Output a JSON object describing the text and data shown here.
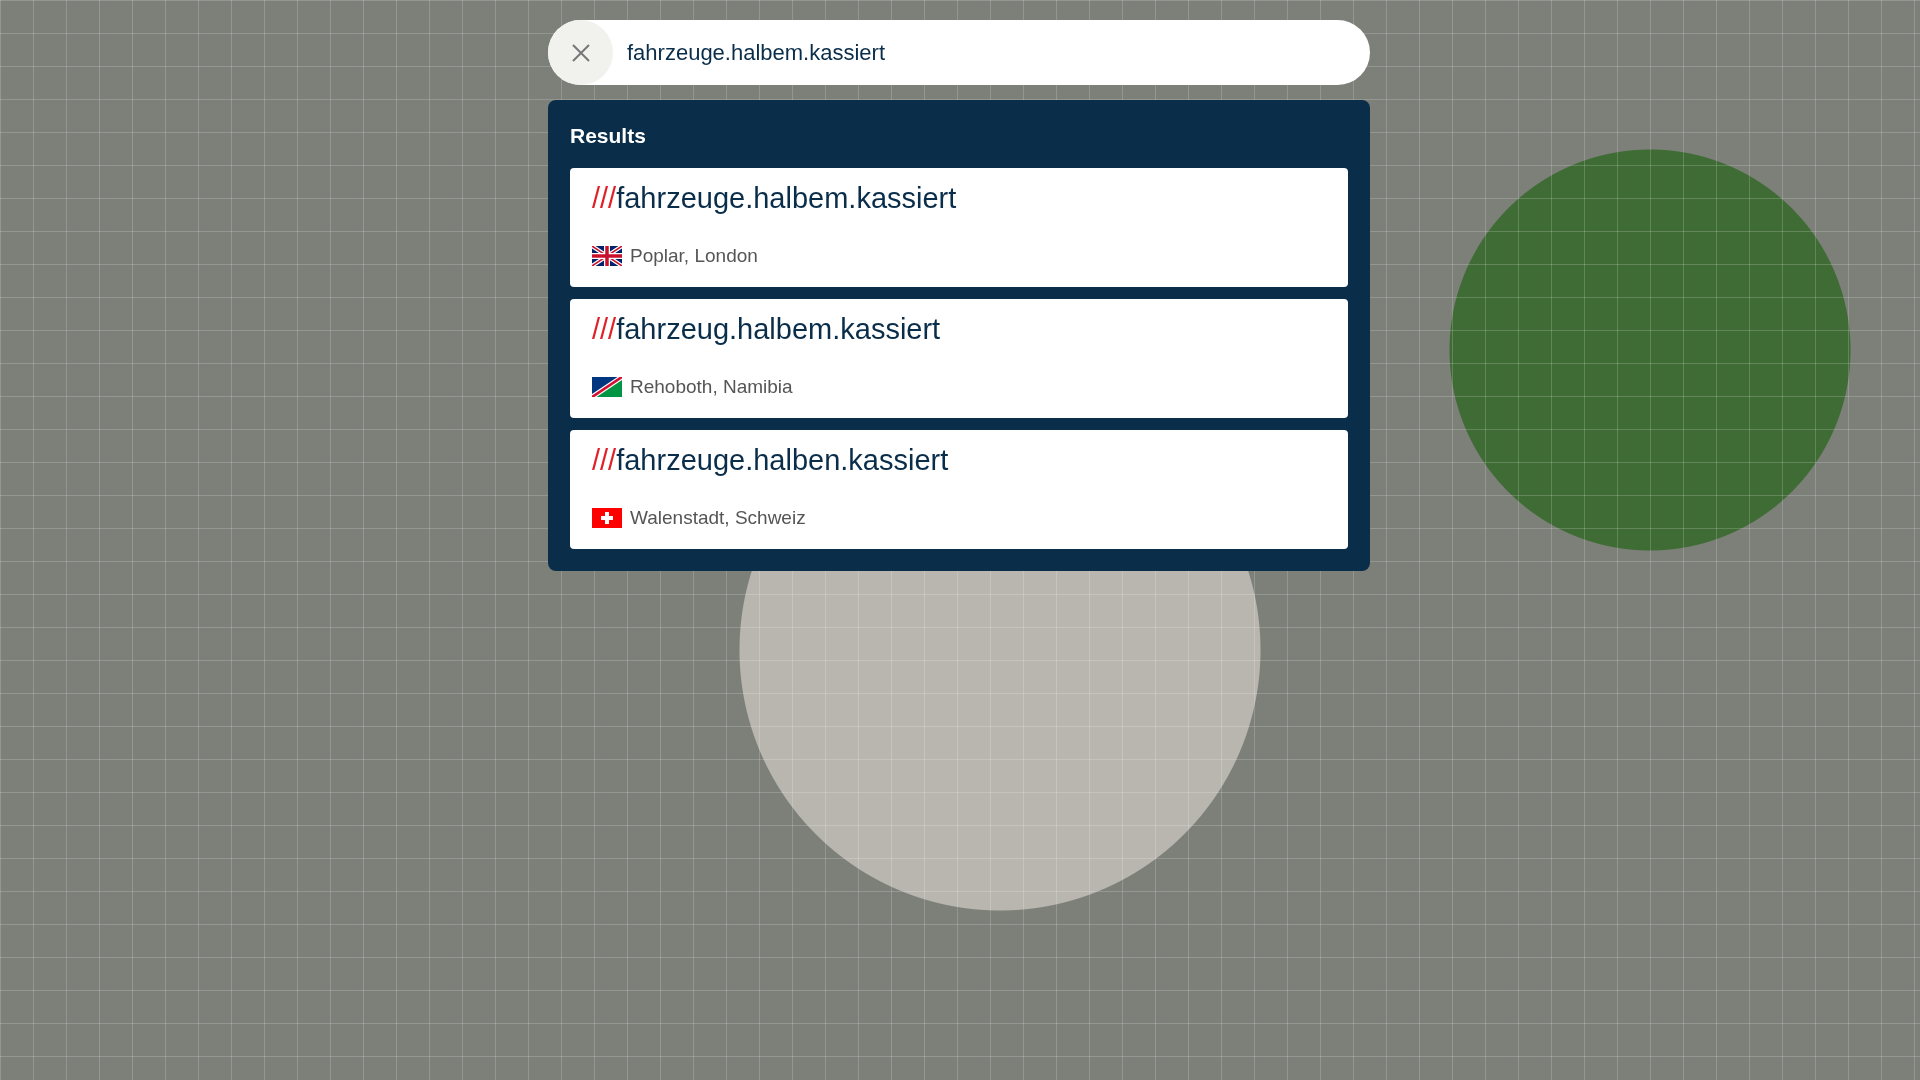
{
  "search": {
    "value": "fahrzeuge.halbem.kassiert"
  },
  "results": {
    "title": "Results",
    "items": [
      {
        "prefix": "///",
        "address": "fahrzeuge.halbem.kassiert",
        "kind": "gb",
        "location": "Poplar, London"
      },
      {
        "prefix": "///",
        "address": "fahrzeug.halbem.kassiert",
        "kind": "na",
        "location": "Rehoboth, Namibia"
      },
      {
        "prefix": "///",
        "address": "fahrzeuge.halben.kassiert",
        "kind": "ch",
        "location": "Walenstadt, Schweiz"
      }
    ]
  }
}
